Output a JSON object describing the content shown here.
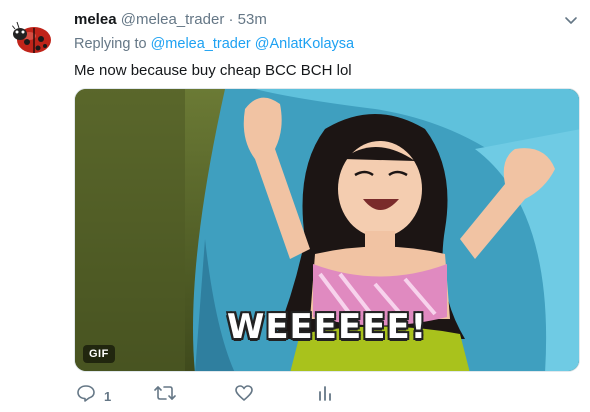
{
  "tweet": {
    "display_name": "melea",
    "handle": "@melea_trader",
    "separator": "·",
    "time": "53m",
    "replying_prefix": "Replying to",
    "reply_handle_1": "@melea_trader",
    "reply_handle_2": "@AnlatKolaysa",
    "text": "Me now because buy cheap BCC BCH lol",
    "media": {
      "badge": "GIF",
      "caption": "WEEEEEE!"
    },
    "actions": {
      "reply_count": "1",
      "retweet_count": "",
      "like_count": ""
    }
  },
  "colors": {
    "accent": "#1da1f2",
    "secondary_text": "#657786",
    "primary_text": "#14171a"
  },
  "icons": [
    "ladybug-avatar",
    "chevron-down-icon",
    "reply-icon",
    "retweet-icon",
    "like-icon",
    "analytics-icon"
  ]
}
